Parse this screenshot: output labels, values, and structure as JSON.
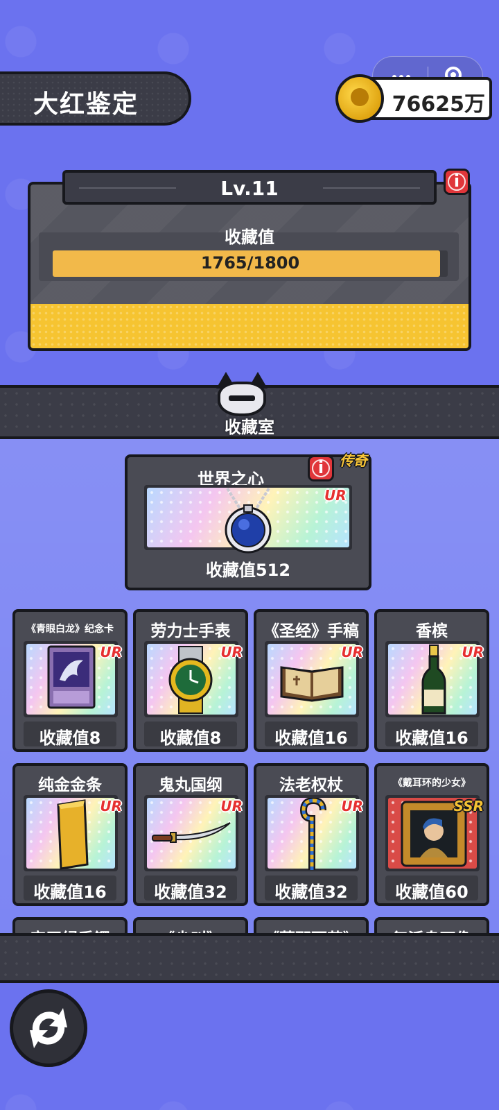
{
  "header": {
    "title": "大红鉴定",
    "coins": "76625万"
  },
  "level": {
    "label": "Lv.11",
    "collection_label": "收藏值",
    "progress_text": "1765/1800",
    "progress_fraction": 0.98
  },
  "room": {
    "label": "收藏室"
  },
  "featured": {
    "name": "世界之心",
    "tag": "传奇",
    "rarity": "UR",
    "value": "收藏值512",
    "icon": "sapphire-necklace-icon"
  },
  "items": [
    {
      "name": "《青眼白龙》纪念卡",
      "rarity": "UR",
      "value": "收藏值8",
      "icon": "dragon-card-icon"
    },
    {
      "name": "劳力士手表",
      "rarity": "UR",
      "value": "收藏值8",
      "icon": "watch-icon"
    },
    {
      "name": "《圣经》手稿",
      "rarity": "UR",
      "value": "收藏值16",
      "icon": "book-icon"
    },
    {
      "name": "香槟",
      "rarity": "UR",
      "value": "收藏值16",
      "icon": "champagne-icon"
    },
    {
      "name": "纯金金条",
      "rarity": "UR",
      "value": "收藏值16",
      "icon": "gold-bar-icon"
    },
    {
      "name": "鬼丸国纲",
      "rarity": "UR",
      "value": "收藏值32",
      "icon": "katana-icon"
    },
    {
      "name": "法老权杖",
      "rarity": "UR",
      "value": "收藏值32",
      "icon": "scepter-icon"
    },
    {
      "name": "《戴耳环的少女》",
      "rarity": "SSR",
      "value": "收藏值60",
      "icon": "painting-icon"
    },
    {
      "name": "帝王绿手镯",
      "rarity": "",
      "value": "",
      "icon": ""
    },
    {
      "name": "《尖叫》",
      "rarity": "",
      "value": "",
      "icon": ""
    },
    {
      "name": "《蒙那丽莎》",
      "rarity": "",
      "value": "",
      "icon": ""
    },
    {
      "name": "复活岛石像",
      "rarity": "",
      "value": "",
      "icon": ""
    }
  ],
  "colors": {
    "background": "#6b72ef",
    "panel": "#4a4b54",
    "accent_yellow": "#f6c431",
    "ur_red": "#e63030"
  }
}
